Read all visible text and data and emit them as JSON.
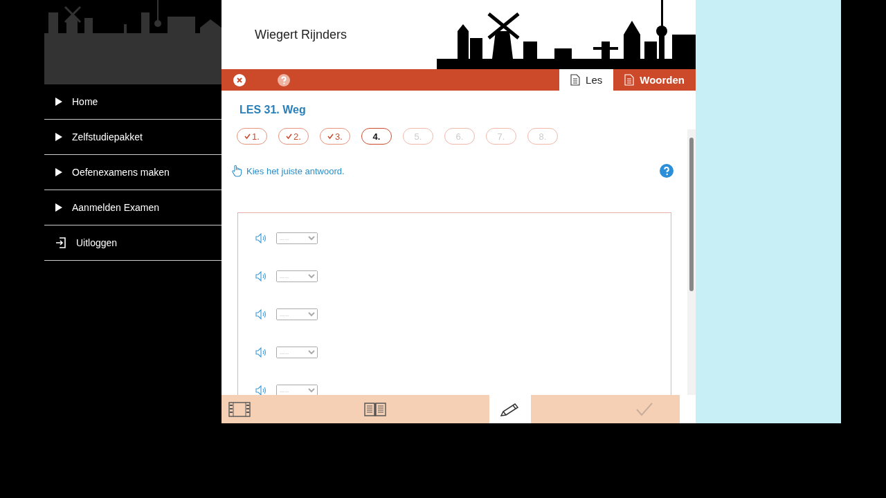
{
  "user": {
    "name": "Wiegert Rijnders"
  },
  "sidebar": {
    "items": [
      {
        "label": "Home",
        "kind": "link"
      },
      {
        "label": "Zelfstudiepakket",
        "kind": "link"
      },
      {
        "label": "Oefenexamens maken",
        "kind": "link"
      },
      {
        "label": "Aanmelden Examen",
        "kind": "link"
      },
      {
        "label": "Uitloggen",
        "kind": "logout"
      }
    ]
  },
  "tabs": [
    {
      "label": "Les",
      "selected": true
    },
    {
      "label": "Woorden",
      "selected": false
    }
  ],
  "lesson": {
    "title": "LES 31. Weg",
    "steps": [
      {
        "label": "1.",
        "checked": true,
        "selected": false,
        "disabled": false
      },
      {
        "label": "2.",
        "checked": true,
        "selected": false,
        "disabled": false
      },
      {
        "label": "3.",
        "checked": true,
        "selected": false,
        "disabled": false
      },
      {
        "label": "4.",
        "checked": false,
        "selected": true,
        "disabled": false
      },
      {
        "label": "5.",
        "checked": false,
        "selected": false,
        "disabled": true
      },
      {
        "label": "6.",
        "checked": false,
        "selected": false,
        "disabled": true
      },
      {
        "label": "7.",
        "checked": false,
        "selected": false,
        "disabled": true
      },
      {
        "label": "8.",
        "checked": false,
        "selected": false,
        "disabled": true
      }
    ],
    "instruction": "Kies het juiste antwoord.",
    "answers": [
      {
        "placeholder": "......"
      },
      {
        "placeholder": "......"
      },
      {
        "placeholder": "......"
      },
      {
        "placeholder": "......"
      },
      {
        "placeholder": "......"
      }
    ]
  },
  "footer": [
    {
      "kind": "film",
      "selected": false,
      "disabled": false
    },
    {
      "kind": "book",
      "selected": false,
      "disabled": false
    },
    {
      "kind": "pencil",
      "selected": true,
      "disabled": false
    },
    {
      "kind": "check",
      "selected": false,
      "disabled": true
    }
  ]
}
